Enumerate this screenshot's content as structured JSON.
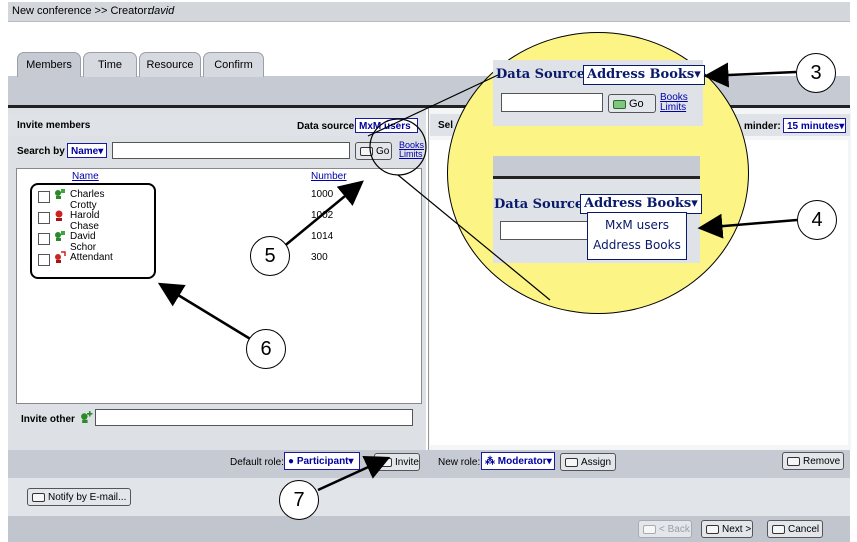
{
  "title": {
    "prefix": "New conference >> Creator: ",
    "creator": "david"
  },
  "tabs": [
    {
      "label": "Members",
      "active": true
    },
    {
      "label": "Time",
      "active": false
    },
    {
      "label": "Resource",
      "active": false
    },
    {
      "label": "Confirm",
      "active": false
    }
  ],
  "invite": {
    "heading": "Invite members",
    "data_source_label": "Data source:",
    "data_source_value": "MxM users",
    "search_by_label": "Search by",
    "search_by_value": "Name",
    "search_value": "",
    "go_label": "Go",
    "books_link": "Books",
    "limits_link": "Limits",
    "col_name": "Name",
    "col_number": "Number",
    "members": [
      {
        "name": "Charles Crotty",
        "number": "1000",
        "icon": "person-green-icon",
        "checked": false
      },
      {
        "name": "Harold Chase",
        "number": "1002",
        "icon": "person-red-icon",
        "checked": false
      },
      {
        "name": "David Schor",
        "number": "1014",
        "icon": "person-green-icon",
        "checked": false
      },
      {
        "name": "Attendant",
        "number": "300",
        "icon": "person-red-icon",
        "checked": false
      }
    ],
    "invite_other_label": "Invite other",
    "invite_other_value": "",
    "default_role_label": "Default role:",
    "default_role_value": "Participant",
    "invite_button": "Invite"
  },
  "selected": {
    "heading_partial": "Sel",
    "reminder_label": "minder:",
    "reminder_value": "15 minutes",
    "new_role_label": "New role:",
    "new_role_value": "Moderator",
    "assign_button": "Assign",
    "remove_button": "Remove"
  },
  "footer": {
    "notify_button": "Notify by E-mail...",
    "back_button": "< Back",
    "next_button": "Next >",
    "cancel_button": "Cancel"
  },
  "magnifier": {
    "ds_label_top": "Data Source:",
    "ds_value_top": "Address Books",
    "go_label": "Go",
    "books_link": "Books",
    "limits_link": "Limits",
    "ds_label_bottom": "Data Source:",
    "ds_value_bottom": "Address Books",
    "options": [
      "MxM users",
      "Address Books"
    ]
  },
  "callouts": [
    "3",
    "4",
    "5",
    "6",
    "7"
  ],
  "colors": {
    "accent": "#0000a0",
    "bubble": "#fcf586",
    "tab_band": "#c5cad3"
  }
}
